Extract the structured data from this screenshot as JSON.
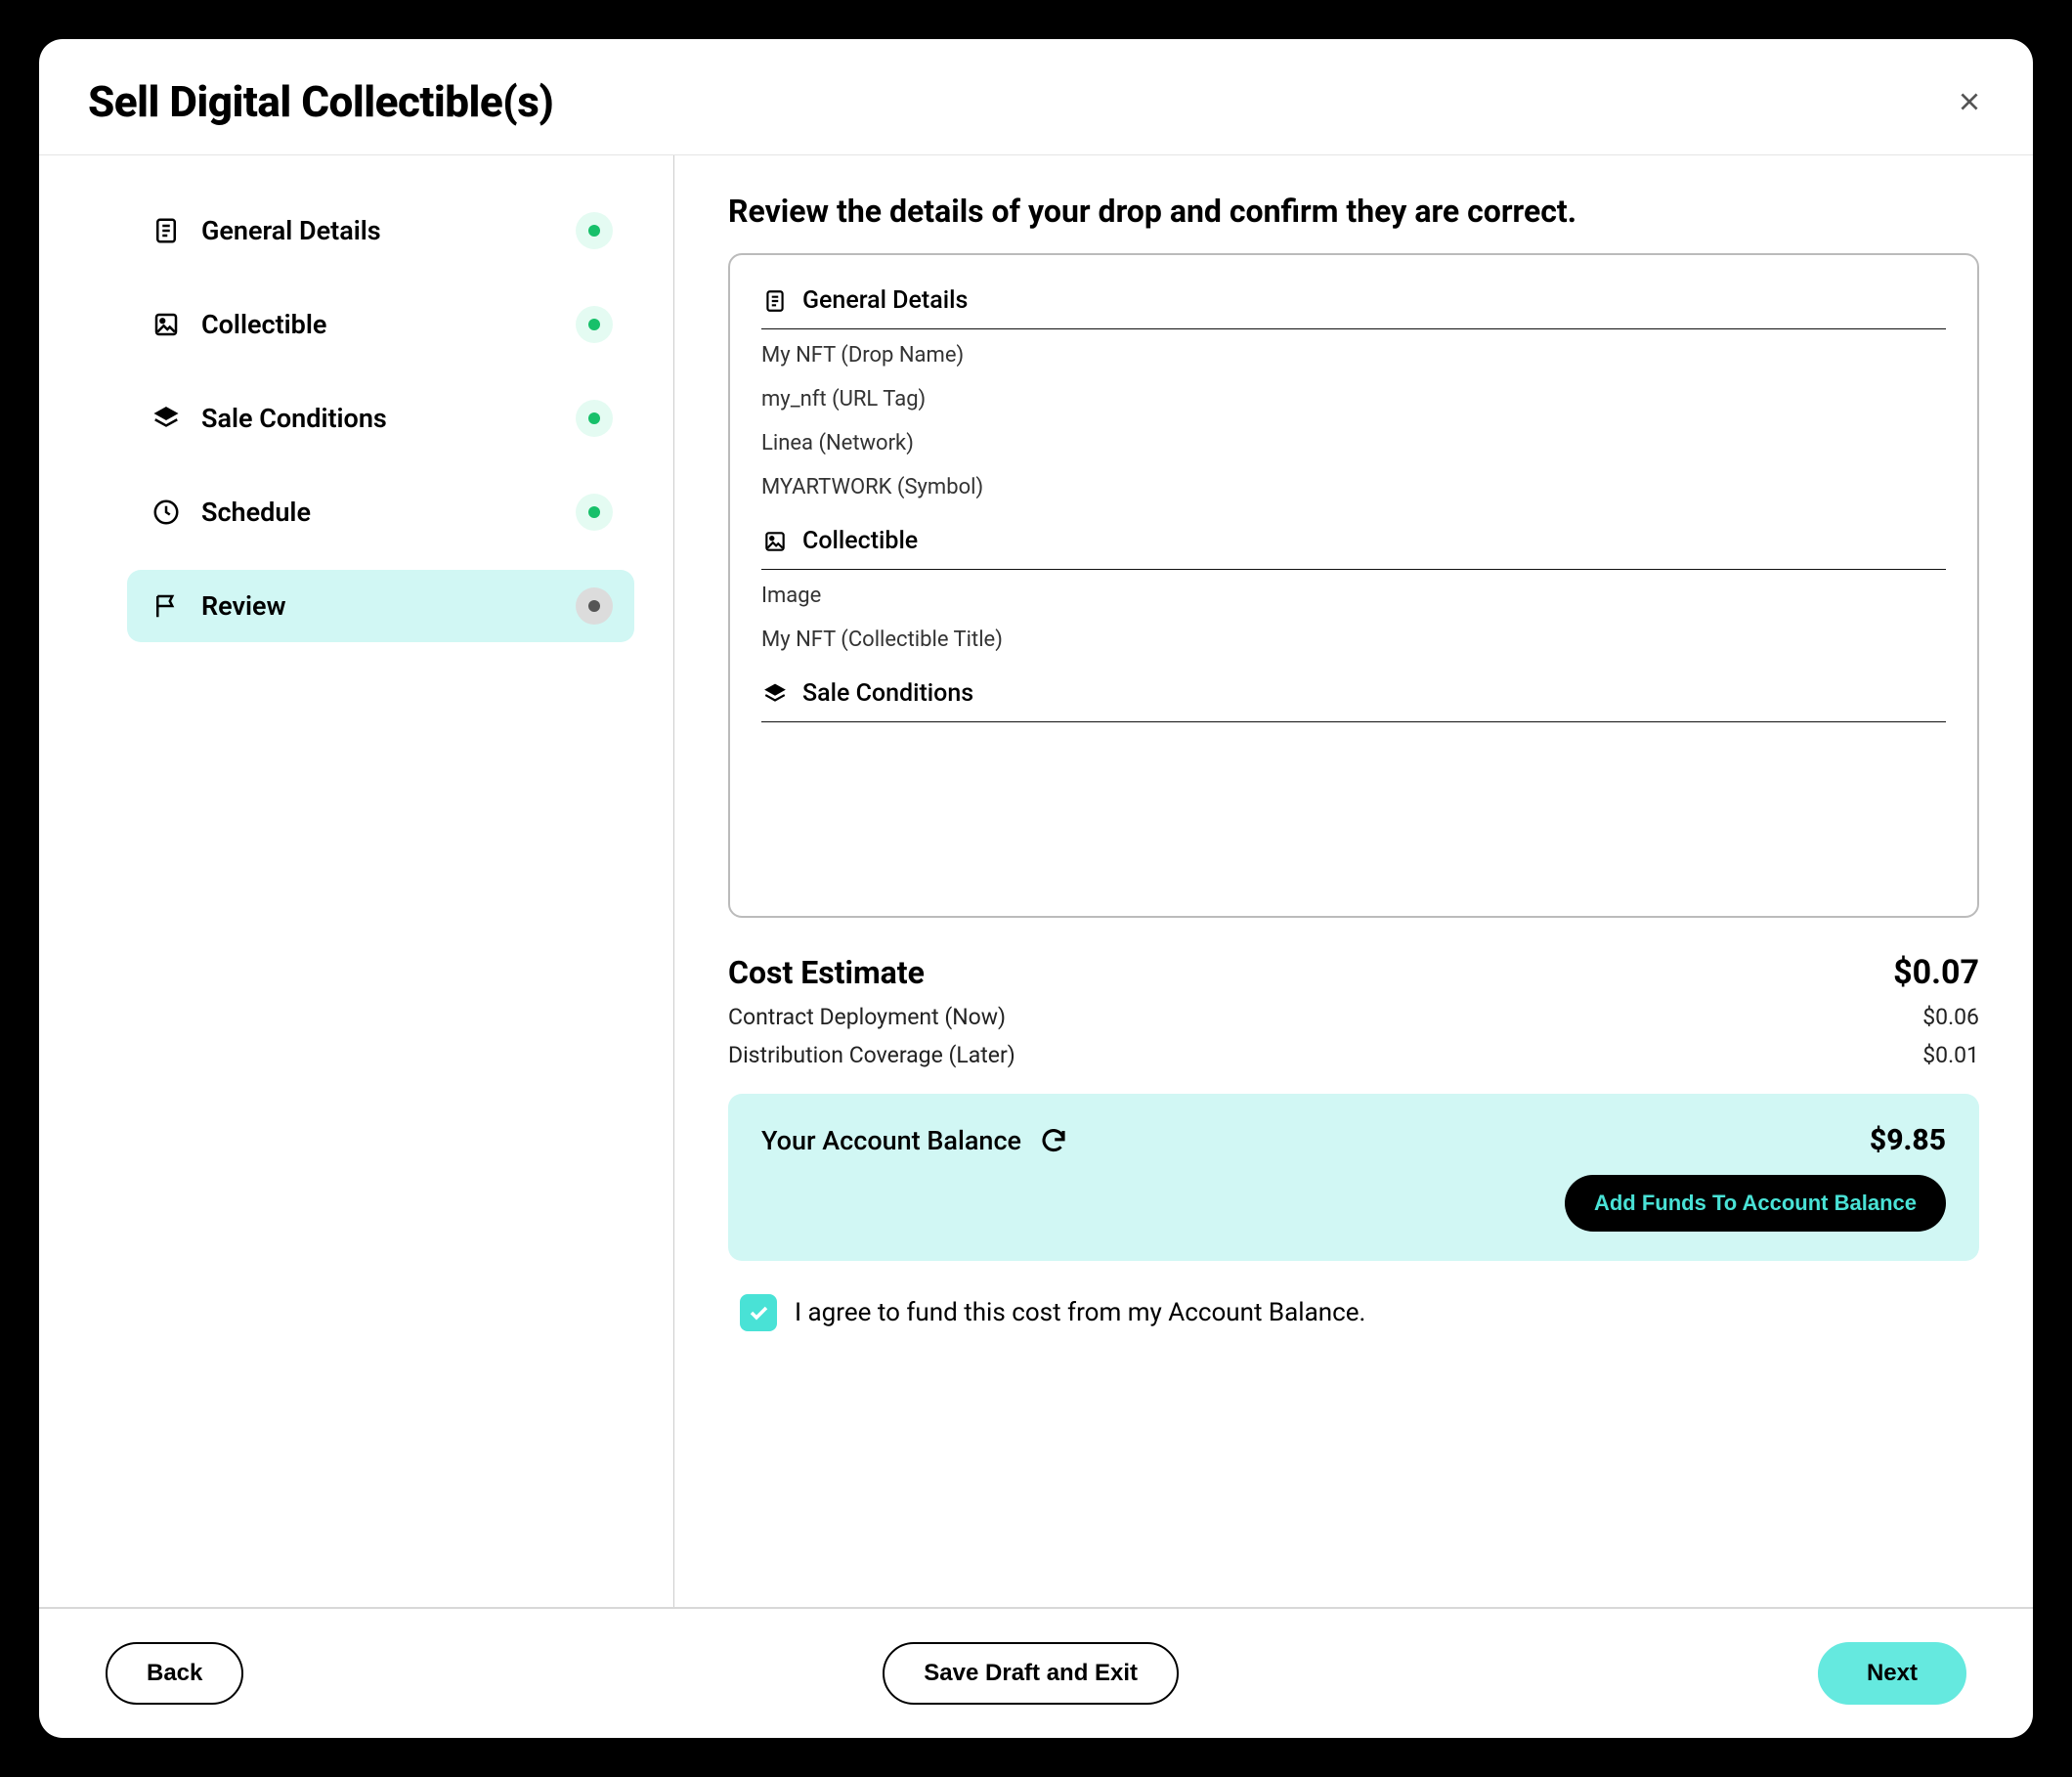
{
  "header": {
    "title": "Sell Digital Collectible(s)"
  },
  "sidebar": {
    "items": [
      {
        "label": "General Details"
      },
      {
        "label": "Collectible"
      },
      {
        "label": "Sale Conditions"
      },
      {
        "label": "Schedule"
      },
      {
        "label": "Review"
      }
    ]
  },
  "main": {
    "heading": "Review the details of your drop and confirm they are correct.",
    "sections": {
      "general": {
        "title": "General Details",
        "lines": [
          "My NFT (Drop Name)",
          "my_nft (URL Tag)",
          "Linea (Network)",
          "MYARTWORK (Symbol)"
        ]
      },
      "collectible": {
        "title": "Collectible",
        "lines": [
          "Image",
          "My NFT (Collectible Title)"
        ]
      },
      "sale": {
        "title": "Sale Conditions"
      }
    },
    "cost": {
      "title": "Cost Estimate",
      "total": "$0.07",
      "items": [
        {
          "label": "Contract Deployment (Now)",
          "value": "$0.06"
        },
        {
          "label": "Distribution Coverage (Later)",
          "value": "$0.01"
        }
      ]
    },
    "balance": {
      "label": "Your Account Balance",
      "amount": "$9.85",
      "add_funds": "Add Funds To Account Balance"
    },
    "agree": {
      "text": "I agree to fund this cost from my Account Balance.",
      "checked": true
    }
  },
  "footer": {
    "back": "Back",
    "draft": "Save Draft and Exit",
    "next": "Next"
  }
}
